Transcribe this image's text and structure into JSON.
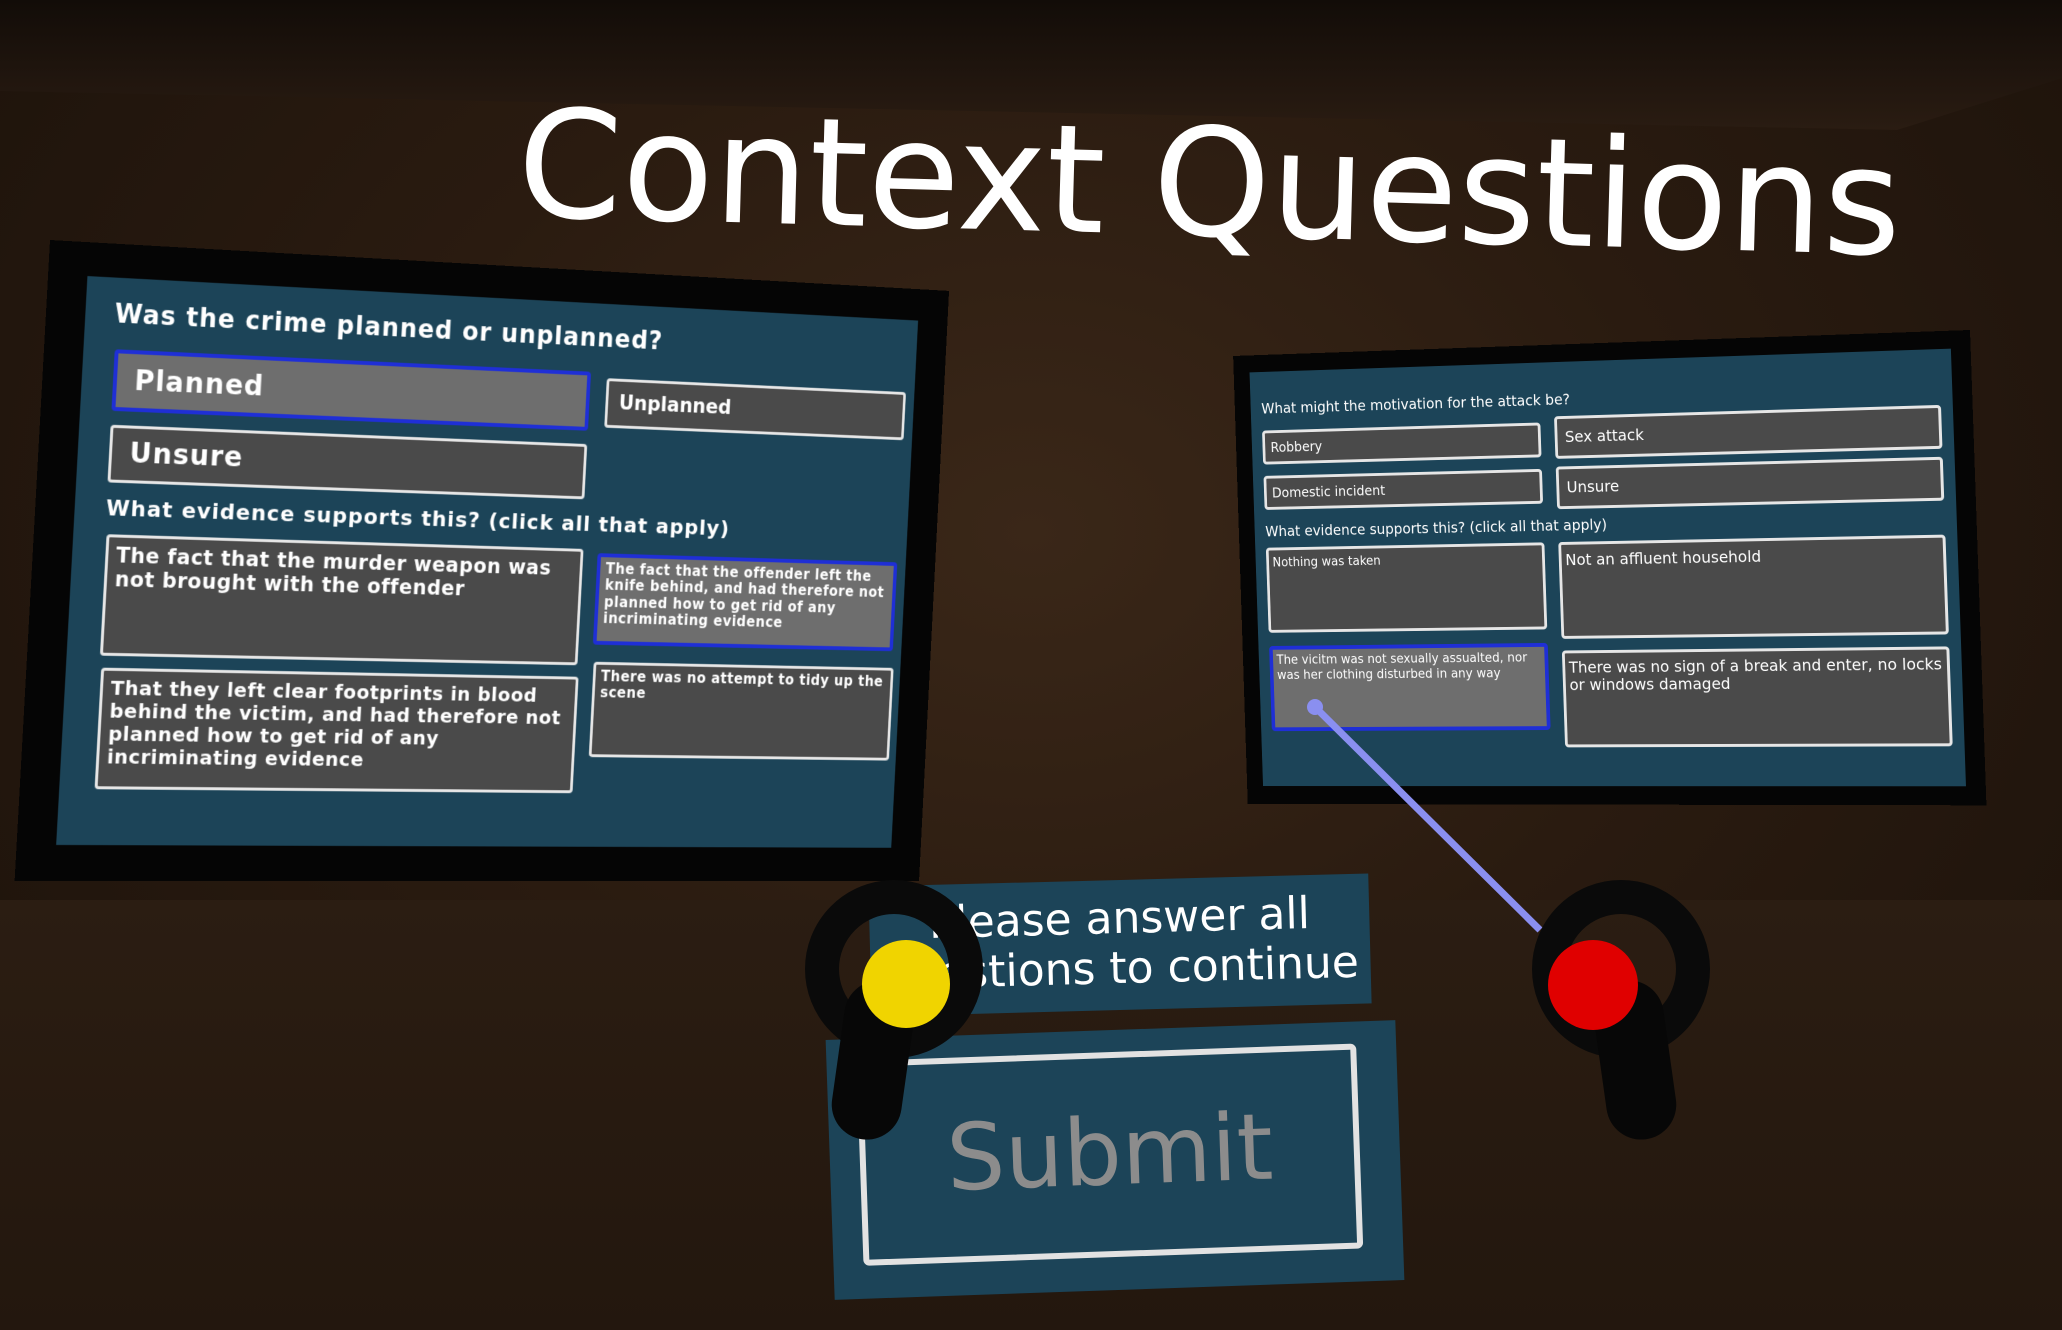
{
  "title": "Context Questions",
  "left_panel": {
    "question1": "Was the crime planned or unplanned?",
    "options": [
      {
        "label": "Planned",
        "selected": true
      },
      {
        "label": "Unplanned",
        "selected": false
      },
      {
        "label": "Unsure",
        "selected": false
      }
    ],
    "evidence_heading": "What evidence supports this? (click all that apply)",
    "evidence": [
      {
        "label": "The fact that the murder weapon was not brought with the offender",
        "selected": false
      },
      {
        "label": "The fact that the offender left the knife behind, and had therefore not planned how to get rid of any incriminating evidence",
        "selected": true
      },
      {
        "label": "That they left clear footprints in blood behind the victim, and had therefore not planned how to get rid of any incriminating evidence",
        "selected": false
      },
      {
        "label": "There was no attempt to tidy up the scene",
        "selected": false
      }
    ]
  },
  "right_panel": {
    "question1": "What might the motivation for the attack be?",
    "options": [
      {
        "label": "Robbery",
        "selected": false
      },
      {
        "label": "Sex attack",
        "selected": false
      },
      {
        "label": "Domestic incident",
        "selected": false
      },
      {
        "label": "Unsure",
        "selected": false
      }
    ],
    "evidence_heading": "What evidence supports this?  (click all that apply)",
    "evidence": [
      {
        "label": "Nothing was taken",
        "selected": false
      },
      {
        "label": "Not an affluent household",
        "selected": false
      },
      {
        "label": "The vicitm was not sexually assualted, nor was her clothing disturbed in any way",
        "selected": true
      },
      {
        "label": "There was no sign of a break and enter, no locks or windows damaged",
        "selected": false
      }
    ]
  },
  "prompt": {
    "line1": "Please answer all",
    "line2": "questions to continue"
  },
  "submit_label": "Submit",
  "controllers": {
    "left_trigger_color": "#f0d400",
    "right_trigger_color": "#e00000",
    "pointer_color": "#8a8ff0"
  }
}
